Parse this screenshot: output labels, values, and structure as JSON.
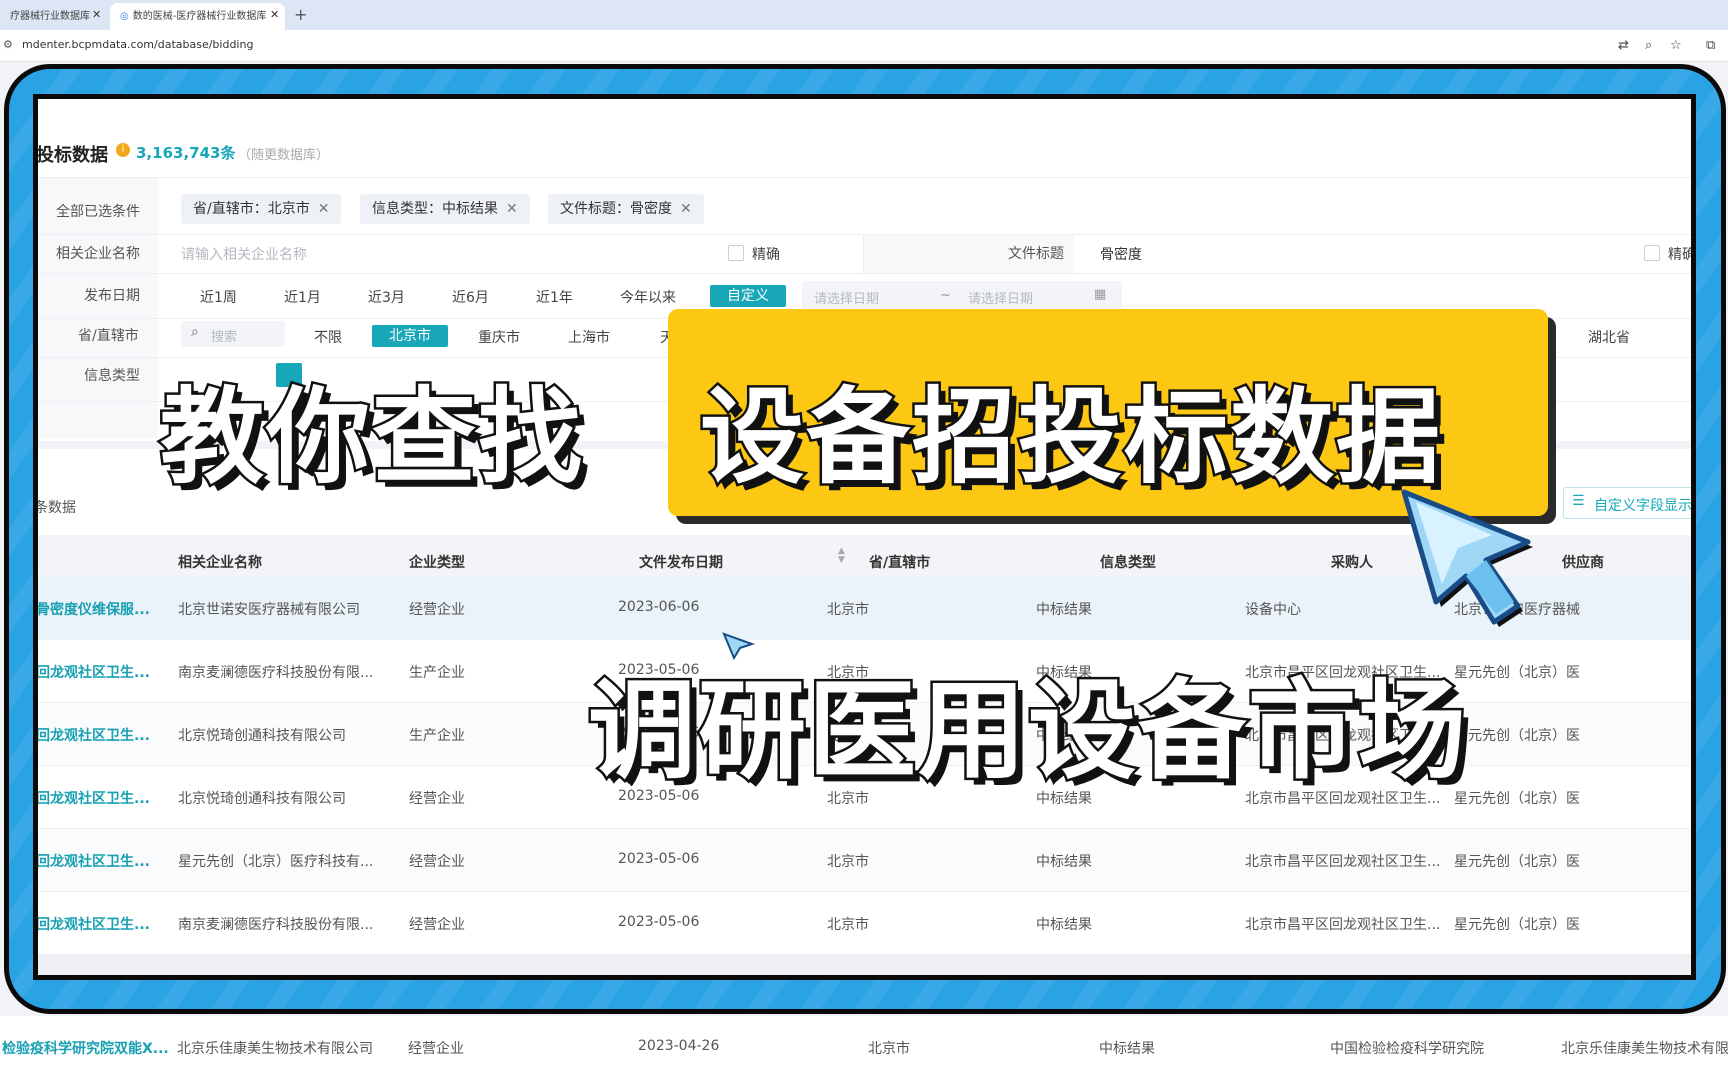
{
  "browser": {
    "tabs": [
      {
        "title": "疗器械行业数据库"
      },
      {
        "title": "数的医械-医疗器械行业数据库"
      }
    ],
    "url": "mdenter.bcpmdata.com/database/bidding"
  },
  "page": {
    "title": "投标数据",
    "count": "3,163,743条",
    "note": "（随更数据库）",
    "filters": {
      "selected_label": "全部已选条件",
      "chips": [
        "省/直辖市：北京市",
        "信息类型：中标结果",
        "文件标题：骨密度"
      ],
      "company_label": "相关企业名称",
      "company_placeholder": "请输入相关企业名称",
      "exact_label": "精确",
      "doc_title_label": "文件标题",
      "doc_title_value": "骨密度",
      "exact_label_2": "精确",
      "date_label": "发布日期",
      "date_options": [
        "近1周",
        "近1月",
        "近3月",
        "近6月",
        "近1年",
        "今年以来",
        "自定义"
      ],
      "date_selected": "自定义",
      "date_start_placeholder": "请选择日期",
      "date_end_placeholder": "请选择日期",
      "date_sep": "~",
      "province_label": "省/直辖市",
      "province_search_placeholder": "搜索",
      "province_options": [
        "不限",
        "北京市",
        "重庆市",
        "上海市",
        "天"
      ],
      "province_selected": "北京市",
      "province_far_right": "湖北省",
      "info_type_label": "信息类型"
    },
    "results_label": "条数据",
    "custom_fields_button": "自定义字段显示",
    "table": {
      "headers": [
        "相关企业名称",
        "企业类型",
        "文件发布日期",
        "省/直辖市",
        "信息类型",
        "采购人",
        "供应商"
      ],
      "rows": [
        [
          "骨密度仪维保服...",
          "北京世诺安医疗器械有限公司",
          "经营企业",
          "2023-06-06",
          "北京市",
          "中标结果",
          "设备中心",
          "北京世诺安医疗器械"
        ],
        [
          "回龙观社区卫生...",
          "南京麦澜德医疗科技股份有限...",
          "生产企业",
          "2023-05-06",
          "北京市",
          "中标结果",
          "北京市昌平区回龙观社区卫生...",
          "星元先创（北京）医"
        ],
        [
          "回龙观社区卫生...",
          "北京悦琦创通科技有限公司",
          "生产企业",
          "2023-05-06",
          "北京市",
          "中标结果",
          "北京市昌平区回龙观社区卫生...",
          "星元先创（北京）医"
        ],
        [
          "回龙观社区卫生...",
          "北京悦琦创通科技有限公司",
          "经营企业",
          "2023-05-06",
          "北京市",
          "中标结果",
          "北京市昌平区回龙观社区卫生...",
          "星元先创（北京）医"
        ],
        [
          "回龙观社区卫生...",
          "星元先创（北京）医疗科技有...",
          "经营企业",
          "2023-05-06",
          "北京市",
          "中标结果",
          "北京市昌平区回龙观社区卫生...",
          "星元先创（北京）医"
        ],
        [
          "回龙观社区卫生...",
          "南京麦澜德医疗科技股份有限...",
          "经营企业",
          "2023-05-06",
          "北京市",
          "中标结果",
          "北京市昌平区回龙观社区卫生...",
          "星元先创（北京）医"
        ]
      ],
      "bottom_row": [
        "检验疫科学研究院双能X...",
        "北京乐佳康美生物技术有限公司",
        "经营企业",
        "2023-04-26",
        "北京市",
        "中标结果",
        "中国检验检疫科学研究院",
        "北京乐佳康美生物技术有限"
      ]
    }
  },
  "overlay": {
    "headline_left": "教你查找",
    "headline_right": "设备招投标数据",
    "subheadline": "调研医用设备市场"
  },
  "colors": {
    "accent": "#17a7b8",
    "frame_blue": "#29a3e4",
    "highlight_yellow": "#fcc814"
  }
}
